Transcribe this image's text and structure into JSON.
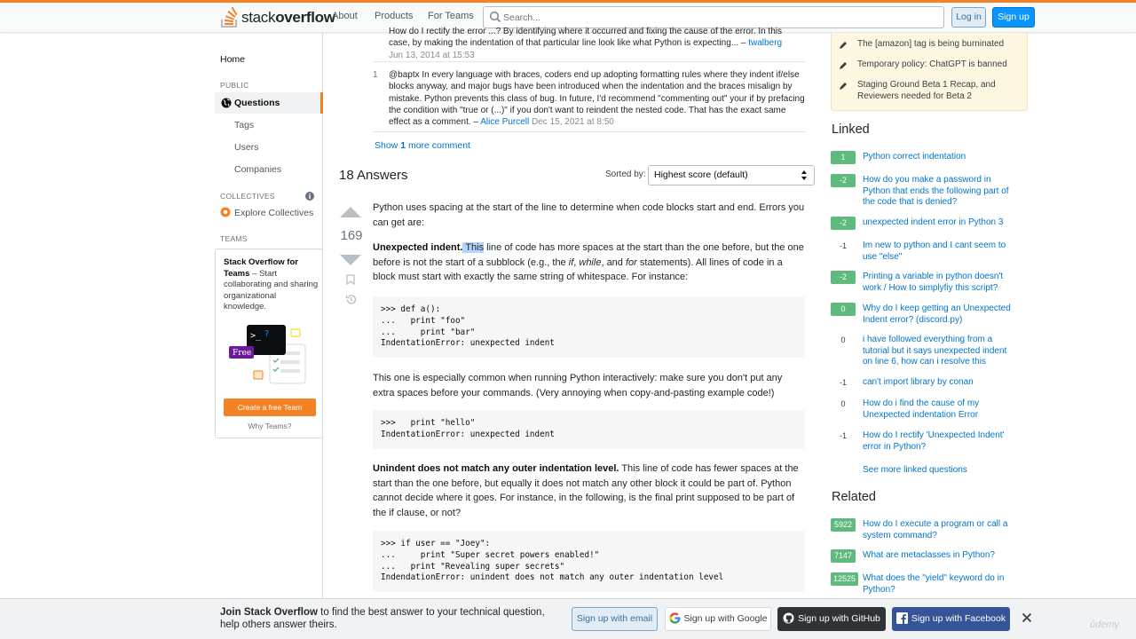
{
  "header": {
    "logo_light": "stack",
    "logo_bold": "overflow",
    "nav": [
      "About",
      "Products",
      "For Teams"
    ],
    "search_placeholder": "Search...",
    "login": "Log in",
    "signup": "Sign up"
  },
  "leftnav": {
    "home": "Home",
    "public_label": "PUBLIC",
    "questions": "Questions",
    "tags": "Tags",
    "users": "Users",
    "companies": "Companies",
    "collectives_label": "COLLECTIVES",
    "explore_collectives": "Explore Collectives",
    "teams_label": "TEAMS",
    "teams_title": "Stack Overflow for Teams",
    "teams_desc": " – Start collaborating and sharing organizational knowledge.",
    "free_badge": "Free",
    "create_team": "Create a free Team",
    "why_teams": "Why Teams?"
  },
  "comments": [
    {
      "score": "",
      "text_partial": "How do I rectify the error ...? By identifying where it occurred and fixing the cause of the error. In this case, by making the indentation of that particular line look like what Python is expecting... – ",
      "author": "twalberg",
      "date": "Jun 13, 2014 at 15:53"
    },
    {
      "score": "1",
      "text": "@baptx In every language with braces, coders end up adopting formatting rules where they indent if/else blocks anyway, and major bugs have been introduced when the indentation and the braces misalign by mistake. Python prevents this class of bug. In future, I'd recommend \"commenting out\" your if by prefacing the condition with \"true or (...)\" if you don't want to reindent the nested code. That has the exact same effect as a comment. – ",
      "author": "Alice Purcell",
      "date": "Dec 15, 2021 at 8:50"
    }
  ],
  "show_more": {
    "prefix": "Show ",
    "count": "1",
    "suffix": " more comment"
  },
  "answers": {
    "count_label": "18 Answers",
    "sorted_by": "Sorted by:",
    "sort_value": "Highest score (default)"
  },
  "answer": {
    "score": "169",
    "p1": "Python uses spacing at the start of the line to determine when code blocks start and end. Errors you can get are:",
    "p2_bold": "Unexpected indent.",
    "p2_highlight": " This",
    "p2_rest_a": " line of code has more spaces at the start than the one before, but the one before is not the start of a subblock (e.g., the ",
    "p2_if": "if",
    "p2_sep1": ", ",
    "p2_while": "while",
    "p2_sep2": ", and ",
    "p2_for": "for",
    "p2_rest_b": " statements). All lines of code in a block must start with exactly the same string of whitespace. For instance:",
    "code1": ">>> def a():\n...   print \"foo\"\n...     print \"bar\"\nIndentationError: unexpected indent",
    "p3": "This one is especially common when running Python interactively: make sure you don't put any extra spaces before your commands. (Very annoying when copy-and-pasting example code!)",
    "code2": ">>>   print \"hello\"\nIndentationError: unexpected indent",
    "p4_bold": "Unindent does not match any outer indentation level.",
    "p4_rest": " This line of code has fewer spaces at the start than the one before, but equally it does not match any other block it could be part of. Python cannot decide where it goes. For instance, in the following, is the final print supposed to be part of the if clause, or not?",
    "code3": ">>> if user == \"Joey\":\n...     print \"Super secret powers enabled!\"\n...   print \"Revealing super secrets\"\nIndendationError: unindent does not match any outer indentation level"
  },
  "blog": [
    "The [amazon] tag is being burninated",
    "Temporary policy: ChatGPT is banned",
    "Staging Ground Beta 1 Recap, and Reviewers needed for Beta 2"
  ],
  "linked": {
    "title": "Linked",
    "items": [
      {
        "score": "1",
        "text": "Python correct indentation"
      },
      {
        "score": "-2",
        "text": "How do you make a password in Python that ends the following part of the code that is denied?"
      },
      {
        "score": "-2",
        "text": "unexpected indent error in Python 3"
      },
      {
        "score": "-1",
        "text": "Im new to python and I cant seem to use \"else\""
      },
      {
        "score": "-2",
        "text": "Printing a variable in python doesn't work / How to simplyfiy this script?"
      },
      {
        "score": "0",
        "text": "Why do I keep getting an Unexpected Indent error? (discord.py)"
      },
      {
        "score": "0",
        "text": "i have followed everything from a tutorial but it says unexpected indent on line 6, how can i resolve this"
      },
      {
        "score": "-1",
        "text": "can't import library by conan"
      },
      {
        "score": "0",
        "text": "How do i find the cause of my Unexpected indentation Error"
      },
      {
        "score": "-1",
        "text": "How do I rectify 'Unexpected Indent' error in Python?"
      }
    ],
    "see_more": "See more linked questions"
  },
  "related": {
    "title": "Related",
    "items": [
      {
        "score": "5922",
        "text": "How do I execute a program or call a system command?"
      },
      {
        "score": "7147",
        "text": "What are metaclasses in Python?"
      },
      {
        "score": "12525",
        "text": "What does the \"yield\" keyword do in Python?"
      }
    ]
  },
  "banner": {
    "bold": "Join Stack Overflow",
    "rest": " to find the best answer to your technical question, help others answer theirs.",
    "email": "Sign up with email",
    "google": "Sign up with Google",
    "github": "Sign up with GitHub",
    "facebook": "Sign up with Facebook"
  },
  "watermark": "ūdemy",
  "colors": {
    "accent": "#f48225",
    "link": "#0074cc",
    "primary_button": "#0a95ff",
    "accepted_green": "#5eba7d",
    "github": "#2f3337",
    "facebook": "#385499"
  }
}
